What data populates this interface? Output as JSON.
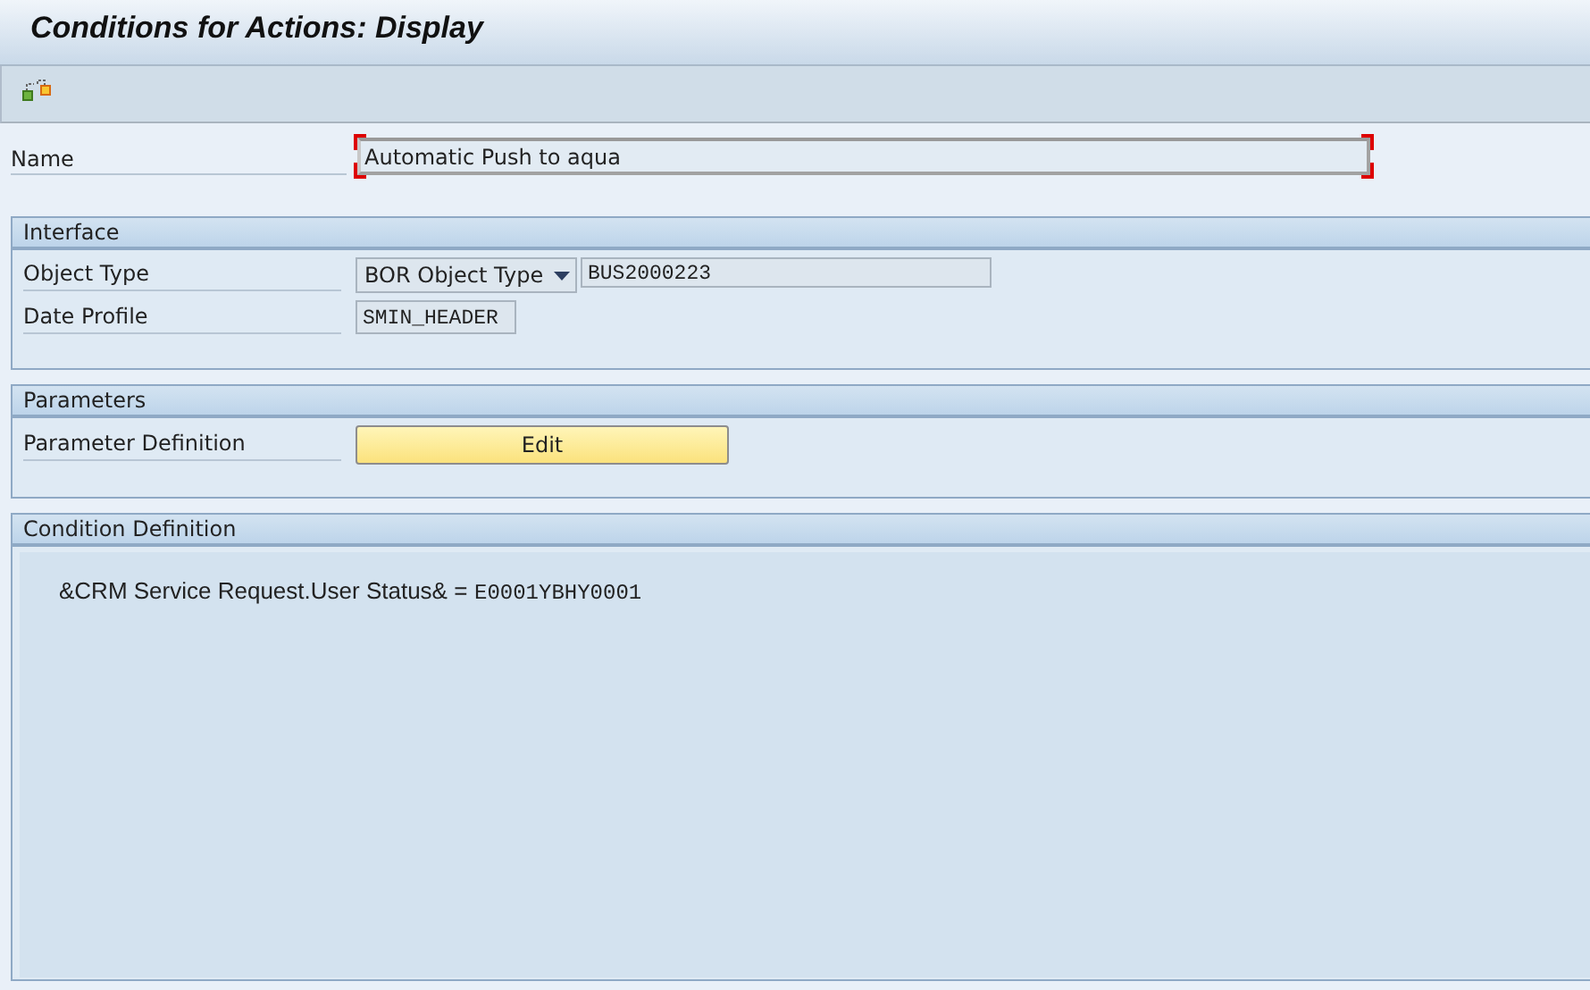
{
  "window": {
    "title": "Conditions for Actions: Display"
  },
  "name": {
    "label": "Name",
    "value": "Automatic Push to aqua",
    "required": true
  },
  "interface": {
    "title": "Interface",
    "rows": [
      {
        "label": "Object Type",
        "kind": "dropdown",
        "option": "BOR Object Type",
        "value": "BUS2000223"
      },
      {
        "label": "Date Profile",
        "kind": "field",
        "value": "SMIN_HEADER"
      }
    ]
  },
  "parameters": {
    "title": "Parameters",
    "label": "Parameter Definition",
    "button": "Edit"
  },
  "condition_definition": {
    "title": "Condition Definition",
    "expression": "&CRM Service Request.User Status& =",
    "value": "E0001YBHY0001"
  }
}
